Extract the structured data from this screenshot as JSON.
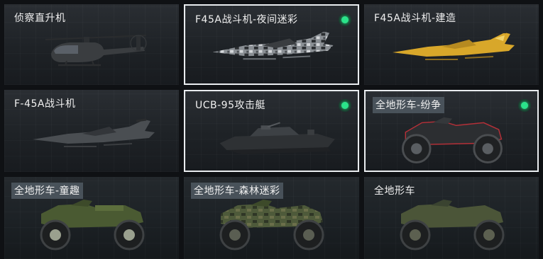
{
  "items": [
    {
      "label": "侦察直升机",
      "selected": false,
      "equipped": false,
      "label_tag": false,
      "icon": "helicopter-icon"
    },
    {
      "label": "F45A战斗机-夜间迷彩",
      "selected": true,
      "equipped": true,
      "label_tag": false,
      "icon": "jet-night-camo-icon"
    },
    {
      "label": "F45A战斗机-建造",
      "selected": false,
      "equipped": false,
      "label_tag": false,
      "icon": "jet-yellow-icon"
    },
    {
      "label": "F-45A战斗机",
      "selected": false,
      "equipped": false,
      "label_tag": false,
      "icon": "jet-gray-icon"
    },
    {
      "label": "UCB-95攻击艇",
      "selected": true,
      "equipped": true,
      "label_tag": false,
      "icon": "attack-boat-icon"
    },
    {
      "label": "全地形车-纷争",
      "selected": true,
      "equipped": true,
      "label_tag": true,
      "icon": "atv-red-icon"
    },
    {
      "label": "全地形车-童趣",
      "selected": false,
      "equipped": false,
      "label_tag": true,
      "icon": "atv-green-icon"
    },
    {
      "label": "全地形车-森林迷彩",
      "selected": false,
      "equipped": false,
      "label_tag": true,
      "icon": "atv-forest-camo-icon"
    },
    {
      "label": "全地形车",
      "selected": false,
      "equipped": false,
      "label_tag": false,
      "icon": "atv-olive-icon"
    }
  ],
  "colors": {
    "equipped_dot": "#2be38a",
    "selected_border": "#e9ecef",
    "background": "#0f1114"
  }
}
